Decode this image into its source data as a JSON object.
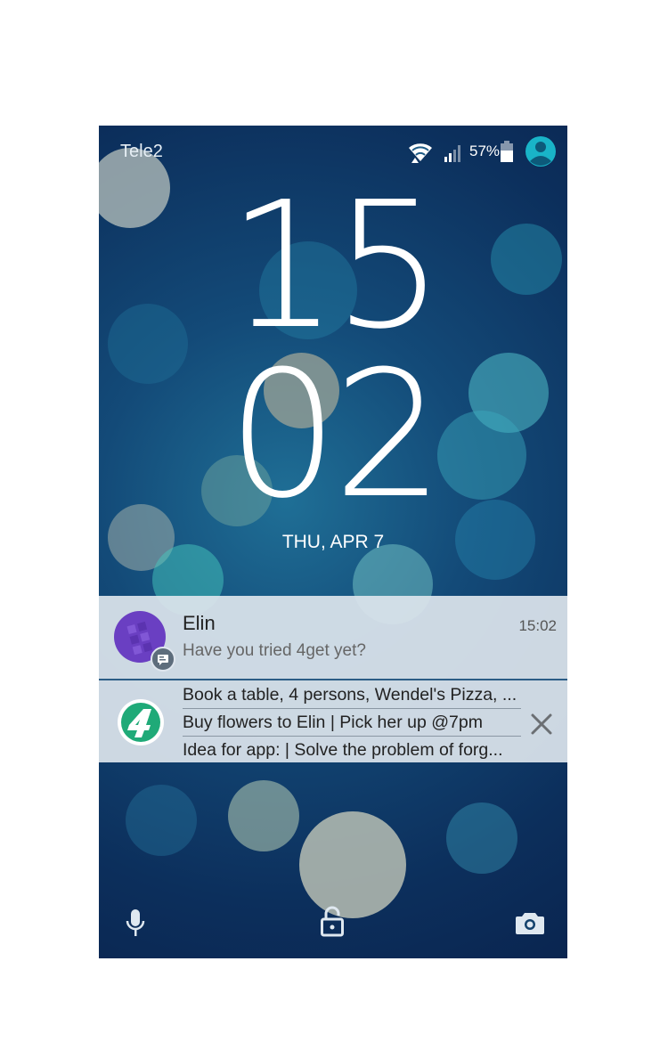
{
  "status_bar": {
    "carrier": "Tele2",
    "battery_percent": "57%",
    "icons": [
      "wifi-icon",
      "signal-icon",
      "battery-icon",
      "user-icon"
    ]
  },
  "clock": {
    "hour": "15",
    "minute": "02",
    "date": "THU, APR 7"
  },
  "notifications": [
    {
      "sender": "Elin",
      "message": "Have you tried 4get yet?",
      "time": "15:02",
      "icons": [
        "avatar",
        "message-badge-icon"
      ]
    },
    {
      "app_icon": "4get-app-icon",
      "items": [
        "Book a table, 4 persons, Wendel's Pizza, ...",
        "Buy flowers to Elin | Pick her up @7pm",
        "Idea for app: | Solve the problem of forg..."
      ],
      "dismiss_icon": "close-icon"
    }
  ],
  "bottom_bar": {
    "icons": [
      "mic-icon",
      "lock-icon",
      "camera-icon"
    ]
  },
  "colors": {
    "background_dark": "#0c2f5c",
    "background_light": "#1f6f96",
    "notification_bg": "#dce4ec",
    "app_accent": "#1faa78",
    "avatar": "#6a3fc2",
    "user_icon": "#19b4c8"
  }
}
